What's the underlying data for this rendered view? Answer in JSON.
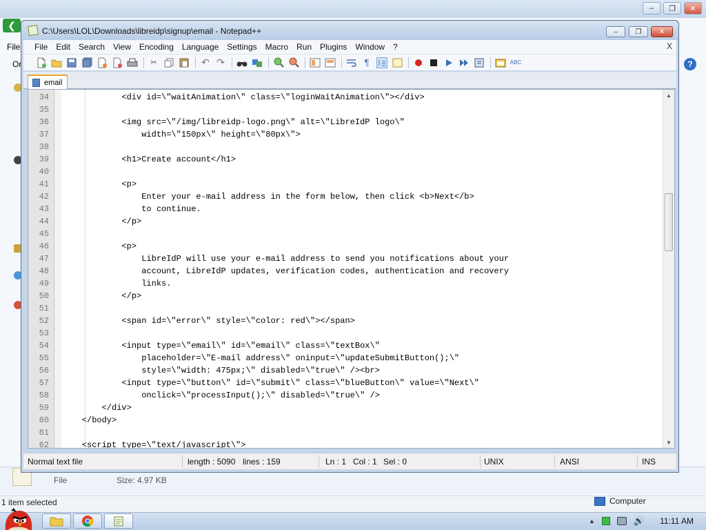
{
  "explorer": {
    "menu_file": "File",
    "toolbar_partial": "Or",
    "detail_type": "File",
    "detail_size": "Size: 4.97 KB",
    "status_left": "1 item selected",
    "status_right": "Computer"
  },
  "taskbar": {
    "clock": "11:11 AM"
  },
  "notepad": {
    "title": "C:\\Users\\LOL\\Downloads\\libreidp\\signup\\email - Notepad++",
    "menu": [
      "File",
      "Edit",
      "Search",
      "View",
      "Encoding",
      "Language",
      "Settings",
      "Macro",
      "Run",
      "Plugins",
      "Window",
      "?"
    ],
    "menu_close": "X",
    "tab_label": "email",
    "lines": [
      {
        "num": "34",
        "code": "            <div id=\\\"waitAnimation\\\" class=\\\"loginWaitAnimation\\\"></div>"
      },
      {
        "num": "35",
        "code": ""
      },
      {
        "num": "36",
        "code": "            <img src=\\\"/img/libreidp-logo.png\\\" alt=\\\"LibreIdP logo\\\""
      },
      {
        "num": "37",
        "code": "                width=\\\"150px\\\" height=\\\"80px\\\">"
      },
      {
        "num": "38",
        "code": ""
      },
      {
        "num": "39",
        "code": "            <h1>Create account</h1>"
      },
      {
        "num": "40",
        "code": ""
      },
      {
        "num": "41",
        "code": "            <p>"
      },
      {
        "num": "42",
        "code": "                Enter your e-mail address in the form below, then click <b>Next</b>"
      },
      {
        "num": "43",
        "code": "                to continue."
      },
      {
        "num": "44",
        "code": "            </p>"
      },
      {
        "num": "45",
        "code": ""
      },
      {
        "num": "46",
        "code": "            <p>"
      },
      {
        "num": "47",
        "code": "                LibreIdP will use your e-mail address to send you notifications about your"
      },
      {
        "num": "48",
        "code": "                account, LibreIdP updates, verification codes, authentication and recovery"
      },
      {
        "num": "49",
        "code": "                links."
      },
      {
        "num": "50",
        "code": "            </p>"
      },
      {
        "num": "51",
        "code": ""
      },
      {
        "num": "52",
        "code": "            <span id=\\\"error\\\" style=\\\"color: red\\\"></span>"
      },
      {
        "num": "53",
        "code": ""
      },
      {
        "num": "54",
        "code": "            <input type=\\\"email\\\" id=\\\"email\\\" class=\\\"textBox\\\""
      },
      {
        "num": "55",
        "code": "                placeholder=\\\"E-mail address\\\" oninput=\\\"updateSubmitButton();\\\""
      },
      {
        "num": "56",
        "code": "                style=\\\"width: 475px;\\\" disabled=\\\"true\\\" /><br>"
      },
      {
        "num": "57",
        "code": "            <input type=\\\"button\\\" id=\\\"submit\\\" class=\\\"blueButton\\\" value=\\\"Next\\\""
      },
      {
        "num": "58",
        "code": "                onclick=\\\"processInput();\\\" disabled=\\\"true\\\" />"
      },
      {
        "num": "59",
        "code": "        </div>"
      },
      {
        "num": "60",
        "code": "    </body>"
      },
      {
        "num": "61",
        "code": ""
      },
      {
        "num": "62",
        "code": "    <script type=\\\"text/javascript\\\">"
      }
    ],
    "status": {
      "file_type": "Normal text file",
      "length": "length : 5090",
      "lines": "lines : 159",
      "ln": "Ln : 1",
      "col": "Col : 1",
      "sel": "Sel : 0",
      "eol": "UNIX",
      "encoding": "ANSI",
      "mode": "INS"
    }
  }
}
